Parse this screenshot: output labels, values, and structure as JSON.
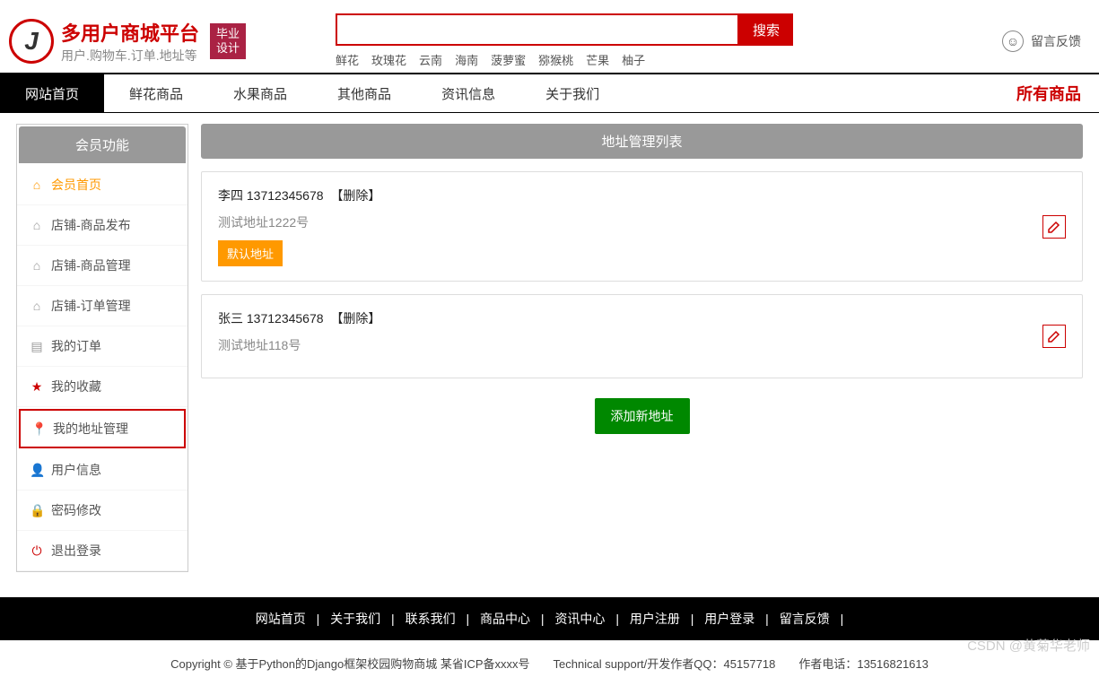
{
  "brand": {
    "title": "多用户商城平台",
    "subtitle": "用户.购物车.订单.地址等",
    "badge_l1": "毕业",
    "badge_l2": "设计"
  },
  "search": {
    "placeholder": "",
    "button": "搜索"
  },
  "hot_tags": [
    "鲜花",
    "玫瑰花",
    "云南",
    "海南",
    "菠萝蜜",
    "猕猴桃",
    "芒果",
    "柚子"
  ],
  "feedback": {
    "label": "留言反馈"
  },
  "nav": {
    "items": [
      "网站首页",
      "鲜花商品",
      "水果商品",
      "其他商品",
      "资讯信息",
      "关于我们"
    ],
    "right": "所有商品"
  },
  "sidebar": {
    "title": "会员功能",
    "items": [
      {
        "icon": "⌂",
        "label": "会员首页",
        "cls": "home"
      },
      {
        "icon": "⌂",
        "label": "店铺-商品发布",
        "cls": ""
      },
      {
        "icon": "⌂",
        "label": "店铺-商品管理",
        "cls": ""
      },
      {
        "icon": "⌂",
        "label": "店铺-订单管理",
        "cls": ""
      },
      {
        "icon": "▤",
        "label": "我的订单",
        "cls": ""
      },
      {
        "icon": "★",
        "label": "我的收藏",
        "cls": "star"
      },
      {
        "icon": "📍",
        "label": "我的地址管理",
        "cls": "selected"
      },
      {
        "icon": "👤",
        "label": "用户信息",
        "cls": "user"
      },
      {
        "icon": "🔒",
        "label": "密码修改",
        "cls": "lock"
      },
      {
        "icon": "⏻",
        "label": "退出登录",
        "cls": "logout"
      }
    ]
  },
  "main": {
    "title": "地址管理列表",
    "addresses": [
      {
        "name": "李四",
        "phone": "13712345678",
        "delete": "【删除】",
        "detail": "测试地址1222号",
        "default": "默认地址"
      },
      {
        "name": "张三",
        "phone": "13712345678",
        "delete": "【删除】",
        "detail": "测试地址118号",
        "default": ""
      }
    ],
    "add_button": "添加新地址"
  },
  "footer": {
    "links": [
      "网站首页",
      "关于我们",
      "联系我们",
      "商品中心",
      "资讯中心",
      "用户注册",
      "用户登录",
      "留言反馈"
    ],
    "info": "Copyright © 基于Python的Django框架校园购物商城 某省ICP备xxxx号　　Technical support/开发作者QQ：45157718　　作者电话：13516821613"
  },
  "watermark": "CSDN @黄菊华老师"
}
